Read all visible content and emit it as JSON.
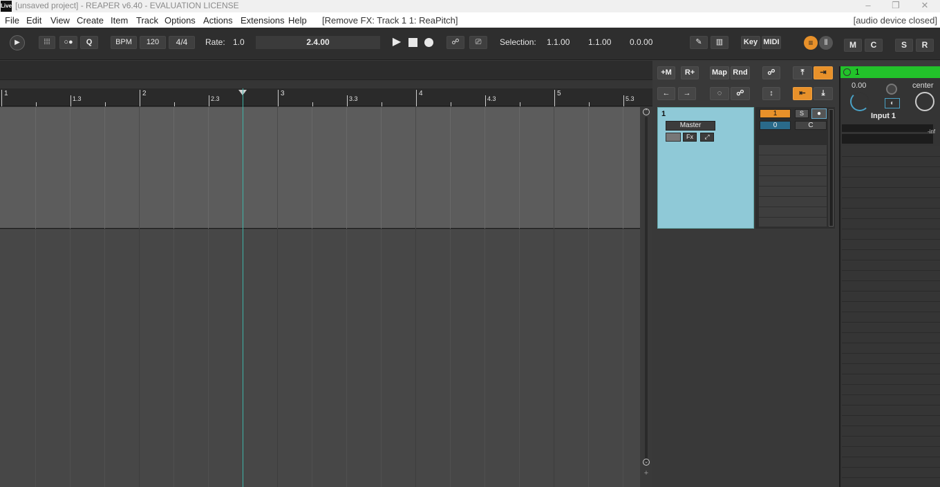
{
  "window": {
    "title": "[unsaved project] - REAPER v6.40 - EVALUATION LICENSE",
    "logo": "Live"
  },
  "menu": {
    "items": [
      "File",
      "Edit",
      "View",
      "Create",
      "Item",
      "Track",
      "Options",
      "Actions",
      "Extensions",
      "Help"
    ],
    "undo_text": "[Remove FX: Track 1 1: ReaPitch]",
    "device_status": "[audio device closed]"
  },
  "transport": {
    "q_label": "Q",
    "bpm_label": "BPM",
    "bpm_value": "120",
    "time_sig": "4/4",
    "rate_label": "Rate:",
    "rate_value": "1.0",
    "position": "2.4.00",
    "selection_label": "Selection:",
    "selection_start": "1.1.00",
    "selection_end": "1.1.00",
    "selection_length": "0.0.00",
    "key_label": "Key",
    "midi_label": "MIDI",
    "m_label": "M",
    "c_label": "C",
    "s_label": "S",
    "r_label": "R"
  },
  "ruler": {
    "labels": [
      "1",
      "1.3",
      "2",
      "2.3",
      "3",
      "3.3",
      "4",
      "4.3",
      "5",
      "5.3"
    ]
  },
  "tcp_toolbar": {
    "add_m": "+M",
    "add_r": "R+",
    "map": "Map",
    "rnd": "Rnd"
  },
  "master": {
    "track_number": "1",
    "name_label": "Master",
    "fx_label": "Fx",
    "volume_value": "1",
    "pan_value": "0",
    "solo_label": "S",
    "c_label": "C"
  },
  "mixer": {
    "track_number": "1",
    "volume_db": "0.00",
    "pan_label": "center",
    "input_label": "Input 1",
    "meter_label": "-inf"
  },
  "colors": {
    "accent_orange": "#e8912a",
    "master_track": "#8fc9d7",
    "mixer_header": "#22c22a",
    "play_cursor": "#3fb5a8"
  }
}
